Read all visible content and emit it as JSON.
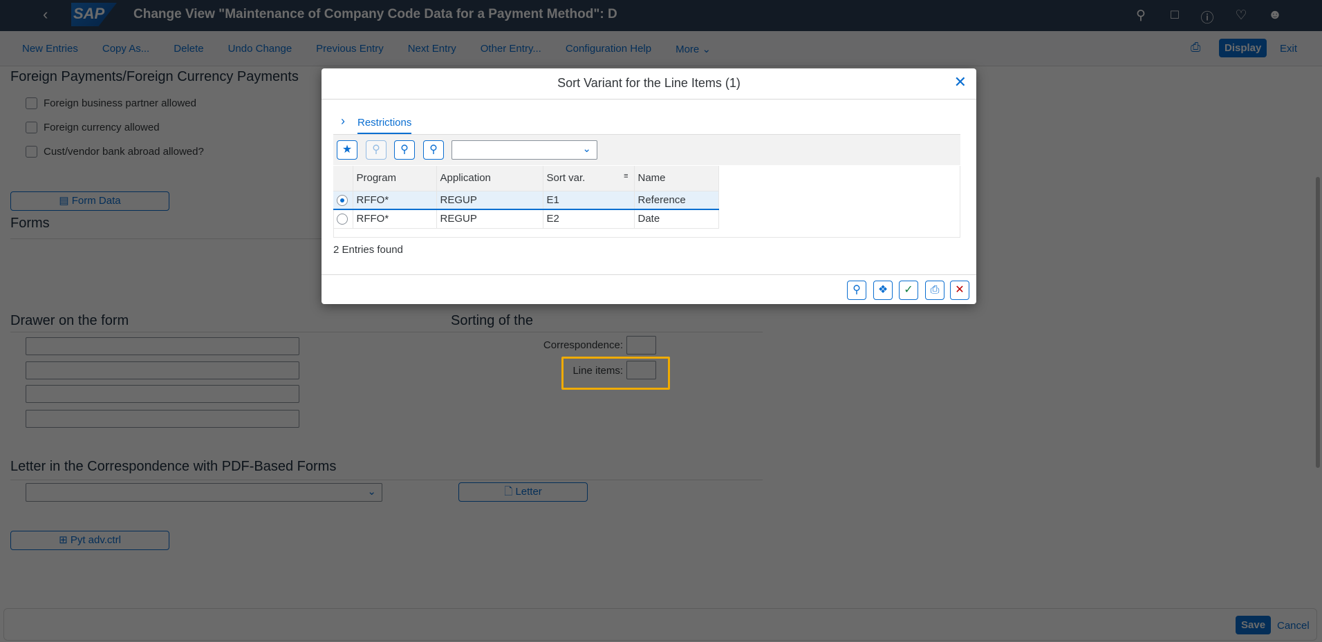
{
  "header": {
    "title": "Change View \"Maintenance of Company Code Data for a Payment Method\": D",
    "logo": "SAP",
    "icons": [
      "search-icon",
      "feedback-icon",
      "help-icon",
      "bell-icon",
      "user-icon"
    ]
  },
  "toolbar": {
    "items": [
      "New Entries",
      "Copy As...",
      "Delete",
      "Undo Change",
      "Previous Entry",
      "Next Entry",
      "Other Entry...",
      "Configuration Help",
      "More"
    ],
    "display": "Display",
    "exit": "Exit"
  },
  "main": {
    "foreign_heading": "Foreign Payments/Foreign Currency Payments",
    "checkboxes": [
      {
        "label": "Foreign business partner allowed",
        "checked": false
      },
      {
        "label": "Foreign currency allowed",
        "checked": false
      },
      {
        "label": "Cust/vendor bank abroad allowed?",
        "checked": false
      }
    ],
    "form_data_button": "Form Data",
    "forms_heading": "Forms",
    "drawer_heading": "Drawer on the form",
    "sorting_heading": "Sorting of the",
    "correspondence_label": "Correspondence:",
    "line_items_label": "Line items:",
    "letter_heading": "Letter in the Correspondence with PDF-Based Forms",
    "letter_button": "Letter",
    "pyt_button": "Pyt adv.ctrl"
  },
  "footer": {
    "save": "Save",
    "cancel": "Cancel"
  },
  "dialog": {
    "title": "Sort Variant for the Line Items (1)",
    "tab": "Restrictions",
    "columns": [
      "Program",
      "Application",
      "Sort var.",
      "Name"
    ],
    "rows": [
      {
        "program": "RFFO*",
        "application": "REGUP",
        "sortvar": "E1",
        "name": "Reference",
        "selected": true
      },
      {
        "program": "RFFO*",
        "application": "REGUP",
        "sortvar": "E2",
        "name": "Date",
        "selected": false
      }
    ],
    "status": "2 Entries found"
  },
  "colors": {
    "accent": "#0a6ed1",
    "highlight": "#f0ab00",
    "shell": "#2c3e55"
  }
}
